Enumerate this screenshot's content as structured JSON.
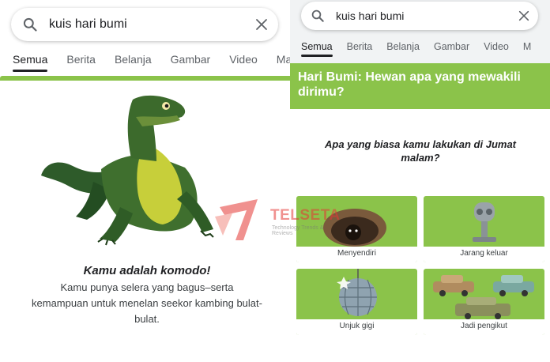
{
  "left": {
    "search": {
      "query": "kuis hari bumi"
    },
    "tabs": [
      "Semua",
      "Berita",
      "Belanja",
      "Gambar",
      "Video",
      "Ma"
    ],
    "result": {
      "title": "Kamu adalah komodo!",
      "description": "Kamu punya selera yang bagus–serta kemampuan untuk menelan seekor kambing bulat-bulat."
    }
  },
  "right": {
    "search": {
      "query": "kuis hari bumi"
    },
    "tabs": [
      "Semua",
      "Berita",
      "Belanja",
      "Gambar",
      "Video",
      "M"
    ],
    "quiz": {
      "title": "Hari Bumi: Hewan apa yang mewakili dirimu?",
      "question": "Apa yang biasa kamu lakukan di Jumat malam?",
      "options": [
        "Menyendiri",
        "Jarang keluar",
        "Unjuk gigi",
        "Jadi pengikut"
      ]
    }
  },
  "watermark": {
    "brand": "TELSETA",
    "tagline": "Technology Trends & Reviews"
  },
  "colors": {
    "accent_green": "#8bc34a",
    "watermark_red": "#e53935"
  },
  "icons": [
    "search-icon",
    "close-icon"
  ]
}
